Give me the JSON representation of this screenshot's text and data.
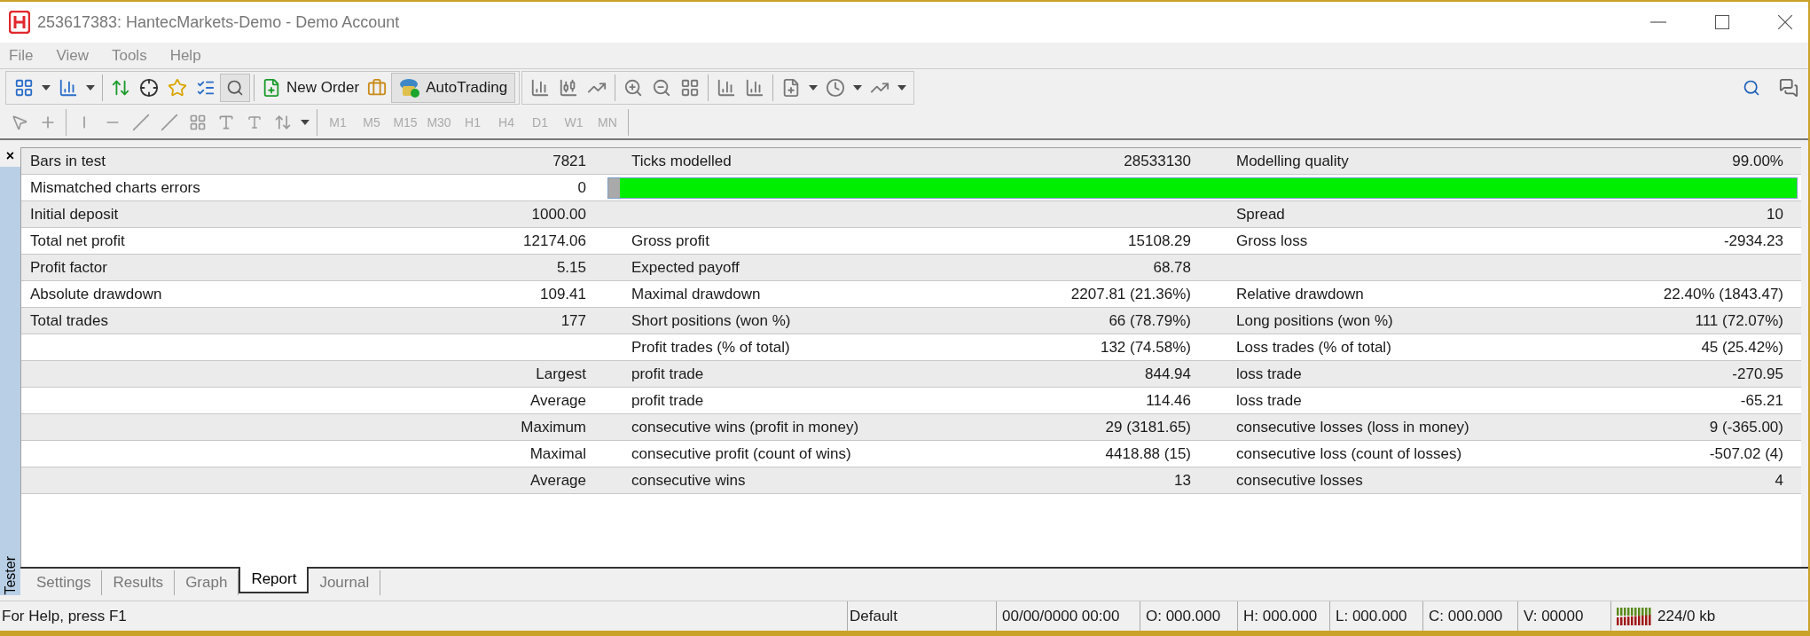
{
  "window": {
    "title": "253617383: HantecMarkets-Demo - Demo Account"
  },
  "menu": [
    "File",
    "View",
    "Tools",
    "Help"
  ],
  "toolbar": {
    "new_order": "New Order",
    "autotrading": "AutoTrading",
    "autotrading_on": true
  },
  "timeframes": [
    {
      "label": "M1",
      "disabled": true
    },
    {
      "label": "M5",
      "disabled": true
    },
    {
      "label": "M15",
      "disabled": true
    },
    {
      "label": "M30",
      "disabled": true
    },
    {
      "label": "H1",
      "disabled": true
    },
    {
      "label": "H4",
      "disabled": true
    },
    {
      "label": "D1",
      "disabled": true
    },
    {
      "label": "W1",
      "disabled": true
    },
    {
      "label": "MN",
      "disabled": true
    }
  ],
  "panel": {
    "side_label": "Tester",
    "close": "×"
  },
  "report_rows": [
    {
      "kind": "stat",
      "c1": "Bars in test",
      "v1": "7821",
      "c2": "Ticks modelled",
      "v2": "28533130",
      "c3": "Modelling quality",
      "v3": "99.00%"
    },
    {
      "kind": "quality",
      "c1": "Mismatched charts errors",
      "v1": "0",
      "level": 0.99
    },
    {
      "kind": "stat",
      "c1": "Initial deposit",
      "v1": "1000.00",
      "c3": "Spread",
      "v3": "10"
    },
    {
      "kind": "stat",
      "c1": "Total net profit",
      "v1": "12174.06",
      "c2": "Gross profit",
      "v2": "15108.29",
      "c3": "Gross loss",
      "v3": "-2934.23"
    },
    {
      "kind": "stat",
      "c1": "Profit factor",
      "v1": "5.15",
      "c2": "Expected payoff",
      "v2": "68.78"
    },
    {
      "kind": "stat",
      "c1": "Absolute drawdown",
      "v1": "109.41",
      "c2": "Maximal drawdown",
      "v2": "2207.81 (21.36%)",
      "c3": "Relative drawdown",
      "v3": "22.40% (1843.47)"
    },
    {
      "kind": "stat",
      "c1": "Total trades",
      "v1": "177",
      "c2": "Short positions (won %)",
      "v2": "66 (78.79%)",
      "c3": "Long positions (won %)",
      "v3": "111 (72.07%)"
    },
    {
      "kind": "stat",
      "c2": "Profit trades (% of total)",
      "v2": "132 (74.58%)",
      "c3": "Loss trades (% of total)",
      "v3": "45 (25.42%)"
    },
    {
      "kind": "group",
      "v1": "Largest",
      "c2": "profit trade",
      "v2": "844.94",
      "c3": "loss trade",
      "v3": "-270.95"
    },
    {
      "kind": "group",
      "v1": "Average",
      "c2": "profit trade",
      "v2": "114.46",
      "c3": "loss trade",
      "v3": "-65.21"
    },
    {
      "kind": "group",
      "v1": "Maximum",
      "c2": "consecutive wins (profit in money)",
      "v2": "29 (3181.65)",
      "c3": "consecutive losses (loss in money)",
      "v3": "9 (-365.00)"
    },
    {
      "kind": "group",
      "v1": "Maximal",
      "c2": "consecutive profit (count of wins)",
      "v2": "4418.88 (15)",
      "c3": "consecutive loss (count of losses)",
      "v3": "-507.02 (4)"
    },
    {
      "kind": "group",
      "v1": "Average",
      "c2": "consecutive wins",
      "v2": "13",
      "c3": "consecutive losses",
      "v3": "4"
    }
  ],
  "tabs": [
    {
      "label": "Settings",
      "selected": false
    },
    {
      "label": "Results",
      "selected": false
    },
    {
      "label": "Graph",
      "selected": false
    },
    {
      "label": "Report",
      "selected": true
    },
    {
      "label": "Journal",
      "selected": false
    }
  ],
  "status_bar": {
    "help": "For Help, press F1",
    "profile": "Default",
    "datetime": "00/00/0000 00:00",
    "open": "O: 000.000",
    "high": "H: 000.000",
    "low": "L: 000.000",
    "close": "C: 000.000",
    "volume": "V: 00000",
    "traffic": "224/0 kb"
  }
}
